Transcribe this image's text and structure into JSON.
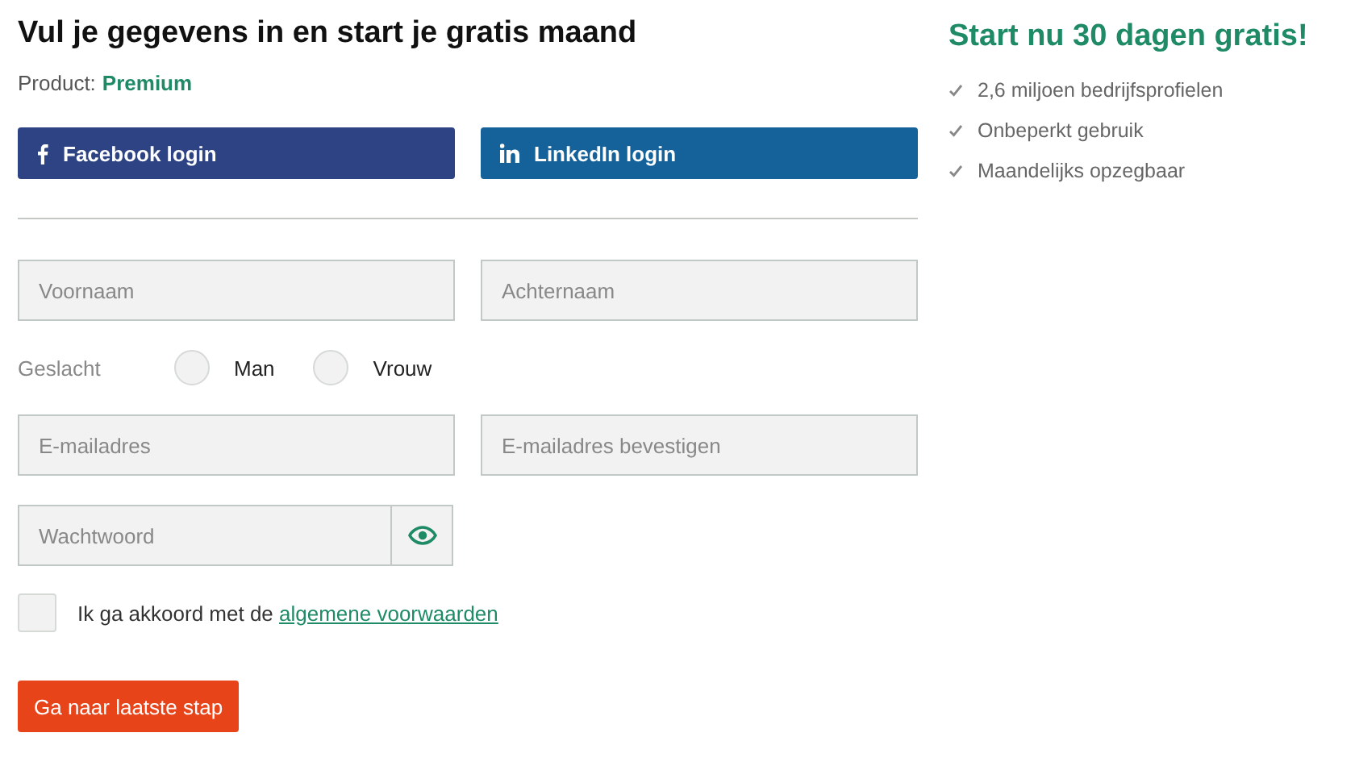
{
  "heading": "Vul je gegevens in en start je gratis maand",
  "product": {
    "label": "Product:",
    "value": "Premium"
  },
  "social_buttons": [
    {
      "kind": "facebook",
      "label": "Facebook login"
    },
    {
      "kind": "linkedin",
      "label": "LinkedIn login"
    }
  ],
  "name_fields": [
    {
      "placeholder": "Voornaam"
    },
    {
      "placeholder": "Achternaam"
    }
  ],
  "gender": {
    "label": "Geslacht",
    "options": [
      {
        "label": "Man",
        "selected": false
      },
      {
        "label": "Vrouw",
        "selected": false
      }
    ]
  },
  "email_fields": [
    {
      "placeholder": "E-mailadres"
    },
    {
      "placeholder": "E-mailadres bevestigen"
    }
  ],
  "password": {
    "placeholder": "Wachtwoord"
  },
  "terms": {
    "checked": false,
    "text": "Ik ga akkoord met de",
    "link": "algemene voorwaarden"
  },
  "submit": "Ga naar laatste stap",
  "aside": {
    "title": "Start nu 30 dagen gratis!",
    "benefits": [
      "2,6 miljoen bedrijfsprofielen",
      "Onbeperkt gebruik",
      "Maandelijks opzegbaar"
    ]
  }
}
